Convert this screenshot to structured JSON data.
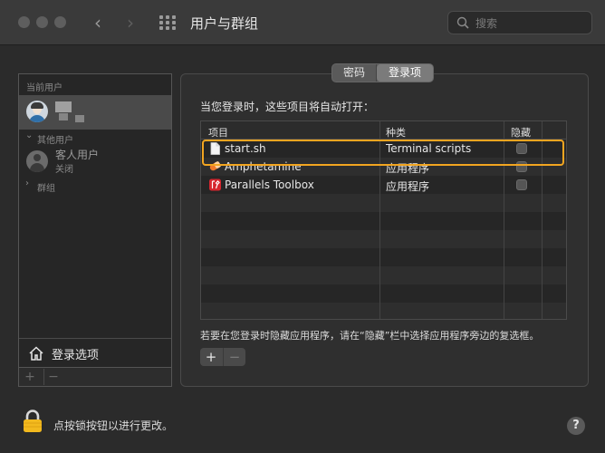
{
  "window": {
    "title": "用户与群组",
    "search_placeholder": "搜索"
  },
  "sidebar": {
    "current_user_label": "当前用户",
    "other_users_label": "其他用户",
    "guest": {
      "name": "客人用户",
      "status": "关闭"
    },
    "groups_label": "群组",
    "login_options": "登录选项",
    "add": "+",
    "remove": "−"
  },
  "tabs": [
    {
      "label": "密码",
      "selected": false
    },
    {
      "label": "登录项",
      "selected": true
    }
  ],
  "main": {
    "heading": "当您登录时，这些项目将自动打开：",
    "columns": [
      "项目",
      "种类",
      "隐藏"
    ],
    "items": [
      {
        "name": "start.sh",
        "kind": "Terminal scripts",
        "hidden": false,
        "icon": "document-icon"
      },
      {
        "name": "Amphetamine",
        "kind": "应用程序",
        "hidden": false,
        "icon": "amphetamine-icon"
      },
      {
        "name": "Parallels Toolbox",
        "kind": "应用程序",
        "hidden": false,
        "icon": "parallels-toolbox-icon"
      }
    ],
    "hint": "若要在您登录时隐藏应用程序，请在“隐藏”栏中选择应用程序旁边的复选框。",
    "add": "+",
    "remove": "−"
  },
  "footer": {
    "lock_text": "点按锁按钮以进行更改。",
    "help": "?"
  },
  "colors": {
    "highlight": "#f2a520",
    "lock": "#f2b91e"
  }
}
